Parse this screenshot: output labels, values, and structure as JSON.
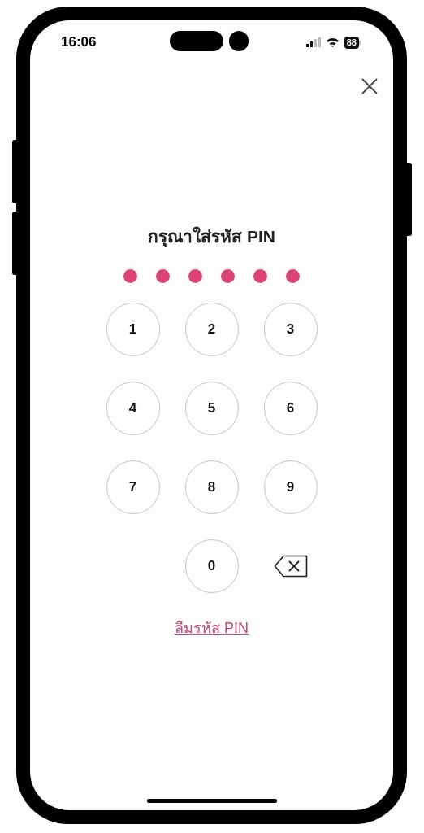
{
  "status_bar": {
    "time": "16:06",
    "battery": "88"
  },
  "title": "กรุณาใส่รหัส PIN",
  "pin_dots": [
    {
      "filled": true
    },
    {
      "filled": true
    },
    {
      "filled": true
    },
    {
      "filled": true
    },
    {
      "filled": true
    },
    {
      "filled": true
    }
  ],
  "keypad": [
    {
      "kind": "digit",
      "label": "1"
    },
    {
      "kind": "digit",
      "label": "2"
    },
    {
      "kind": "digit",
      "label": "3"
    },
    {
      "kind": "digit",
      "label": "4"
    },
    {
      "kind": "digit",
      "label": "5"
    },
    {
      "kind": "digit",
      "label": "6"
    },
    {
      "kind": "digit",
      "label": "7"
    },
    {
      "kind": "digit",
      "label": "8"
    },
    {
      "kind": "digit",
      "label": "9"
    },
    {
      "kind": "blank"
    },
    {
      "kind": "digit",
      "label": "0"
    },
    {
      "kind": "backspace"
    }
  ],
  "forgot_link": "ลืมรหัส PIN"
}
